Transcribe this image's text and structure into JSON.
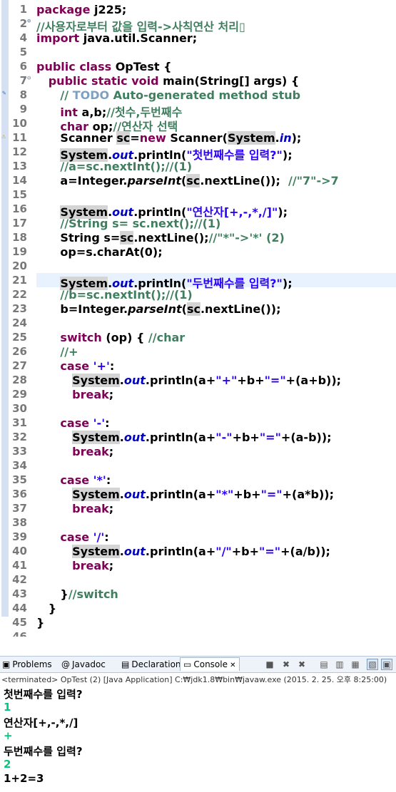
{
  "editor": {
    "lines": [
      {
        "num": "1",
        "fold": "",
        "segs": [
          {
            "t": "package ",
            "c": "kw"
          },
          {
            "t": "j225;"
          }
        ]
      },
      {
        "num": "2",
        "fold": "+",
        "segs": [
          {
            "t": "//사용자로부터 값을 입력->사칙연산 처리",
            "c": "cm"
          },
          {
            "t": "▯",
            "c": "cm"
          }
        ]
      },
      {
        "num": "4",
        "fold": "",
        "segs": [
          {
            "t": "import ",
            "c": "kw"
          },
          {
            "t": "java.util.Scanner;"
          }
        ]
      },
      {
        "num": "5",
        "fold": "",
        "segs": []
      },
      {
        "num": "6",
        "fold": "",
        "segs": [
          {
            "t": "public class ",
            "c": "kw"
          },
          {
            "t": "OpTest {"
          }
        ]
      },
      {
        "num": "7",
        "fold": "-",
        "segs": [
          {
            "t": "   "
          },
          {
            "t": "public static void ",
            "c": "kw"
          },
          {
            "t": "main(String[] args) {"
          }
        ]
      },
      {
        "num": "8",
        "fold": "",
        "segs": [
          {
            "t": "      "
          },
          {
            "t": "// ",
            "c": "cm"
          },
          {
            "t": "TODO",
            "c": "todo"
          },
          {
            "t": " Auto-generated method stub",
            "c": "cm"
          }
        ]
      },
      {
        "num": "9",
        "fold": "",
        "segs": [
          {
            "t": "      "
          },
          {
            "t": "int ",
            "c": "kw"
          },
          {
            "t": "a,b;"
          },
          {
            "t": "//첫수,두번째수",
            "c": "cm"
          }
        ]
      },
      {
        "num": "10",
        "fold": "",
        "segs": [
          {
            "t": "      "
          },
          {
            "t": "char ",
            "c": "kw"
          },
          {
            "t": "op;"
          },
          {
            "t": "//연산자 선택",
            "c": "cm"
          }
        ]
      },
      {
        "num": "11",
        "fold": "",
        "segs": [
          {
            "t": "      Scanner "
          },
          {
            "t": "sc",
            "c": "occ"
          },
          {
            "t": "="
          },
          {
            "t": "new ",
            "c": "kw"
          },
          {
            "t": "Scanner("
          },
          {
            "t": "System",
            "c": "occ"
          },
          {
            "t": "."
          },
          {
            "t": "in",
            "c": "fld"
          },
          {
            "t": ");"
          }
        ]
      },
      {
        "num": "12",
        "fold": "",
        "segs": [
          {
            "t": "      "
          },
          {
            "t": "System",
            "c": "occ"
          },
          {
            "t": "."
          },
          {
            "t": "out",
            "c": "fld"
          },
          {
            "t": ".println("
          },
          {
            "t": "\"첫번째수를 입력?\"",
            "c": "st"
          },
          {
            "t": ");"
          }
        ]
      },
      {
        "num": "13",
        "fold": "",
        "segs": [
          {
            "t": "      "
          },
          {
            "t": "//a=sc.nextInt();//(1)",
            "c": "cm"
          }
        ]
      },
      {
        "num": "14",
        "fold": "",
        "segs": [
          {
            "t": "      a=Integer."
          },
          {
            "t": "parseInt",
            "c": "it"
          },
          {
            "t": "("
          },
          {
            "t": "sc",
            "c": "occ"
          },
          {
            "t": ".nextLine());  "
          },
          {
            "t": "//\"7\"->7",
            "c": "cm"
          }
        ]
      },
      {
        "num": "15",
        "fold": "",
        "segs": []
      },
      {
        "num": "16",
        "fold": "",
        "segs": [
          {
            "t": "      "
          },
          {
            "t": "System",
            "c": "occ"
          },
          {
            "t": "."
          },
          {
            "t": "out",
            "c": "fld"
          },
          {
            "t": ".println("
          },
          {
            "t": "\"연산자[+,-,*,/]\"",
            "c": "st"
          },
          {
            "t": ");"
          }
        ]
      },
      {
        "num": "17",
        "fold": "",
        "segs": [
          {
            "t": "      "
          },
          {
            "t": "//String s= sc.next();//(1)",
            "c": "cm"
          }
        ]
      },
      {
        "num": "18",
        "fold": "",
        "segs": [
          {
            "t": "      String s="
          },
          {
            "t": "sc",
            "c": "occ"
          },
          {
            "t": ".nextLine();"
          },
          {
            "t": "//\"*\"->'*' (2)",
            "c": "cm"
          }
        ]
      },
      {
        "num": "19",
        "fold": "",
        "segs": [
          {
            "t": "      op=s.charAt(0);"
          }
        ]
      },
      {
        "num": "20",
        "fold": "",
        "segs": []
      },
      {
        "num": "21",
        "fold": "",
        "hl": true,
        "segs": [
          {
            "t": "      "
          },
          {
            "t": "System",
            "c": "occ"
          },
          {
            "t": "."
          },
          {
            "t": "out",
            "c": "fld"
          },
          {
            "t": ".println("
          },
          {
            "t": "\"두번째수를 입력?\"",
            "c": "st"
          },
          {
            "t": ");"
          }
        ]
      },
      {
        "num": "22",
        "fold": "",
        "segs": [
          {
            "t": "      "
          },
          {
            "t": "//b=sc.nextInt();//(1)",
            "c": "cm"
          }
        ]
      },
      {
        "num": "23",
        "fold": "",
        "segs": [
          {
            "t": "      b=Integer."
          },
          {
            "t": "parseInt",
            "c": "it"
          },
          {
            "t": "("
          },
          {
            "t": "sc",
            "c": "occ"
          },
          {
            "t": ".nextLine());"
          }
        ]
      },
      {
        "num": "24",
        "fold": "",
        "segs": []
      },
      {
        "num": "25",
        "fold": "",
        "segs": [
          {
            "t": "      "
          },
          {
            "t": "switch ",
            "c": "kw"
          },
          {
            "t": "(op) { "
          },
          {
            "t": "//char",
            "c": "cm"
          }
        ]
      },
      {
        "num": "26",
        "fold": "",
        "segs": [
          {
            "t": "      "
          },
          {
            "t": "//+",
            "c": "cm"
          }
        ]
      },
      {
        "num": "27",
        "fold": "",
        "segs": [
          {
            "t": "      "
          },
          {
            "t": "case ",
            "c": "kw"
          },
          {
            "t": "'+'",
            "c": "st"
          },
          {
            "t": ":"
          }
        ]
      },
      {
        "num": "28",
        "fold": "",
        "segs": [
          {
            "t": "         "
          },
          {
            "t": "System",
            "c": "occ"
          },
          {
            "t": "."
          },
          {
            "t": "out",
            "c": "fld"
          },
          {
            "t": ".println(a+"
          },
          {
            "t": "\"+\"",
            "c": "st"
          },
          {
            "t": "+b+"
          },
          {
            "t": "\"=\"",
            "c": "st"
          },
          {
            "t": "+(a+b));"
          }
        ]
      },
      {
        "num": "29",
        "fold": "",
        "segs": [
          {
            "t": "         "
          },
          {
            "t": "break",
            "c": "kw"
          },
          {
            "t": ";"
          }
        ]
      },
      {
        "num": "30",
        "fold": "",
        "segs": []
      },
      {
        "num": "31",
        "fold": "",
        "segs": [
          {
            "t": "      "
          },
          {
            "t": "case ",
            "c": "kw"
          },
          {
            "t": "'-'",
            "c": "st"
          },
          {
            "t": ":"
          }
        ]
      },
      {
        "num": "32",
        "fold": "",
        "segs": [
          {
            "t": "         "
          },
          {
            "t": "System",
            "c": "occ"
          },
          {
            "t": "."
          },
          {
            "t": "out",
            "c": "fld"
          },
          {
            "t": ".println(a+"
          },
          {
            "t": "\"-\"",
            "c": "st"
          },
          {
            "t": "+b+"
          },
          {
            "t": "\"=\"",
            "c": "st"
          },
          {
            "t": "+(a-b));"
          }
        ]
      },
      {
        "num": "33",
        "fold": "",
        "segs": [
          {
            "t": "         "
          },
          {
            "t": "break",
            "c": "kw"
          },
          {
            "t": ";"
          }
        ]
      },
      {
        "num": "34",
        "fold": "",
        "segs": []
      },
      {
        "num": "35",
        "fold": "",
        "segs": [
          {
            "t": "      "
          },
          {
            "t": "case ",
            "c": "kw"
          },
          {
            "t": "'*'",
            "c": "st"
          },
          {
            "t": ":"
          }
        ]
      },
      {
        "num": "36",
        "fold": "",
        "segs": [
          {
            "t": "         "
          },
          {
            "t": "System",
            "c": "occ"
          },
          {
            "t": "."
          },
          {
            "t": "out",
            "c": "fld"
          },
          {
            "t": ".println(a+"
          },
          {
            "t": "\"*\"",
            "c": "st"
          },
          {
            "t": "+b+"
          },
          {
            "t": "\"=\"",
            "c": "st"
          },
          {
            "t": "+(a*b));"
          }
        ]
      },
      {
        "num": "37",
        "fold": "",
        "segs": [
          {
            "t": "         "
          },
          {
            "t": "break",
            "c": "kw"
          },
          {
            "t": ";"
          }
        ]
      },
      {
        "num": "38",
        "fold": "",
        "segs": []
      },
      {
        "num": "39",
        "fold": "",
        "segs": [
          {
            "t": "      "
          },
          {
            "t": "case ",
            "c": "kw"
          },
          {
            "t": "'/'",
            "c": "st"
          },
          {
            "t": ":"
          }
        ]
      },
      {
        "num": "40",
        "fold": "",
        "segs": [
          {
            "t": "         "
          },
          {
            "t": "System",
            "c": "occ"
          },
          {
            "t": "."
          },
          {
            "t": "out",
            "c": "fld"
          },
          {
            "t": ".println(a+"
          },
          {
            "t": "\"/\"",
            "c": "st"
          },
          {
            "t": "+b+"
          },
          {
            "t": "\"=\"",
            "c": "st"
          },
          {
            "t": "+(a/b));"
          }
        ]
      },
      {
        "num": "41",
        "fold": "",
        "segs": [
          {
            "t": "         "
          },
          {
            "t": "break",
            "c": "kw"
          },
          {
            "t": ";"
          }
        ]
      },
      {
        "num": "42",
        "fold": "",
        "segs": []
      },
      {
        "num": "43",
        "fold": "",
        "segs": [
          {
            "t": "      }"
          },
          {
            "t": "//switch",
            "c": "cm"
          }
        ]
      },
      {
        "num": "44",
        "fold": "",
        "segs": [
          {
            "t": "   }"
          }
        ]
      },
      {
        "num": "45",
        "fold": "",
        "segs": [
          {
            "t": "}"
          }
        ]
      },
      {
        "num": "46",
        "fold": "",
        "segs": []
      }
    ]
  },
  "views": {
    "tabs": [
      {
        "label": "Problems",
        "icon": "problems-icon",
        "glyph": "▣"
      },
      {
        "label": "Javadoc",
        "icon": "javadoc-icon",
        "glyph": "@"
      },
      {
        "label": "Declaration",
        "icon": "declaration-icon",
        "glyph": "▤"
      },
      {
        "label": "Console",
        "icon": "console-icon",
        "glyph": "▭",
        "active": true,
        "close": "✕"
      }
    ],
    "toolbar": [
      {
        "name": "terminate-icon",
        "glyph": "■"
      },
      {
        "name": "remove-launch-icon",
        "glyph": "✖"
      },
      {
        "name": "remove-all-terminated-icon",
        "glyph": "✖"
      },
      {
        "name": "clear-console-icon",
        "glyph": "▤"
      },
      {
        "name": "scroll-lock-icon",
        "glyph": "▥"
      },
      {
        "name": "word-wrap-icon",
        "glyph": "▦"
      },
      {
        "name": "pin-console-icon",
        "glyph": "▧"
      },
      {
        "name": "display-selected-console-icon",
        "glyph": "▣"
      },
      {
        "name": "open-console-icon",
        "glyph": "▭"
      }
    ]
  },
  "console": {
    "status": "<terminated> OpTest (2) [Java Application] C:₩jdk1.8₩bin₩javaw.exe (2015. 2. 25. 오후 8:25:00)",
    "output": [
      {
        "t": "첫번째수를 입력?",
        "k": "sys"
      },
      {
        "t": "1",
        "k": "inp"
      },
      {
        "t": "연산자[+,-,*,/]",
        "k": "sys"
      },
      {
        "t": "+",
        "k": "inp"
      },
      {
        "t": "두번째수를 입력?",
        "k": "sys"
      },
      {
        "t": "2",
        "k": "inp"
      },
      {
        "t": "1+2=3",
        "k": "sys"
      }
    ]
  },
  "colors": {
    "keyword": "#7f0055",
    "comment": "#3f7f5f",
    "string": "#2a00ff",
    "field": "#0000c0",
    "todo": "#7f9fbf",
    "console_input": "#00c87d"
  }
}
